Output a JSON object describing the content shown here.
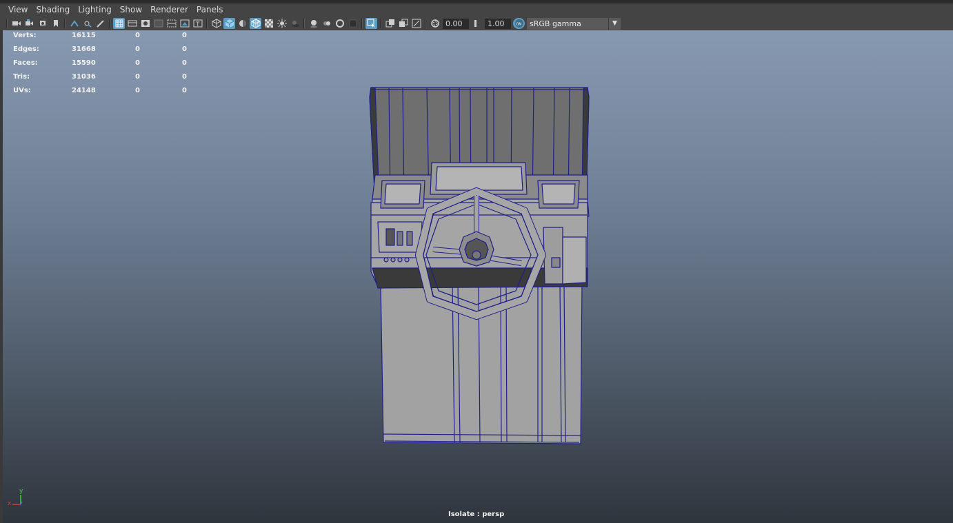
{
  "menubar": {
    "items": [
      "View",
      "Shading",
      "Lighting",
      "Show",
      "Renderer",
      "Panels"
    ]
  },
  "toolbar": {
    "exposure": "0.00",
    "gamma": "1.00",
    "color_space": "sRGB gamma",
    "icons": [
      "camera-icon",
      "camera-attributes-icon",
      "bookmark-icon",
      "image-plane-icon",
      "two-d-pan-icon",
      "grease-pencil-icon",
      "grid-icon",
      "film-gate-icon",
      "resolution-gate-icon",
      "gate-mask-icon",
      "field-chart-icon",
      "safe-action-icon",
      "safe-title-icon",
      "wireframe-icon",
      "smooth-shade-icon",
      "default-material-icon",
      "wireframe-on-shaded-icon",
      "textured-icon",
      "use-all-lights-icon",
      "shadows-icon",
      "screen-space-ao-icon",
      "motion-blur-icon",
      "multisample-aa-icon",
      "depth-of-field-icon",
      "isolate-select-icon",
      "xray-icon",
      "xray-active-components-icon",
      "xray-joints-icon",
      "exposure-icon",
      "gamma-icon",
      "color-management-icon",
      "dropdown-arrow-icon"
    ],
    "accent_color": "#5d9cc2"
  },
  "hud": {
    "rows": [
      {
        "label": "Verts:",
        "v1": "16115",
        "v2": "0",
        "v3": "0"
      },
      {
        "label": "Edges:",
        "v1": "31668",
        "v2": "0",
        "v3": "0"
      },
      {
        "label": "Faces:",
        "v1": "15590",
        "v2": "0",
        "v3": "0"
      },
      {
        "label": "Tris:",
        "v1": "31036",
        "v2": "0",
        "v3": "0"
      },
      {
        "label": "UVs:",
        "v1": "24148",
        "v2": "0",
        "v3": "0"
      }
    ]
  },
  "viewport": {
    "camera_label": "Isolate : persp",
    "axis_x": "x",
    "axis_y": "y",
    "wire_color": "#1f1f8a",
    "model_fill": "#9a9a9a"
  }
}
